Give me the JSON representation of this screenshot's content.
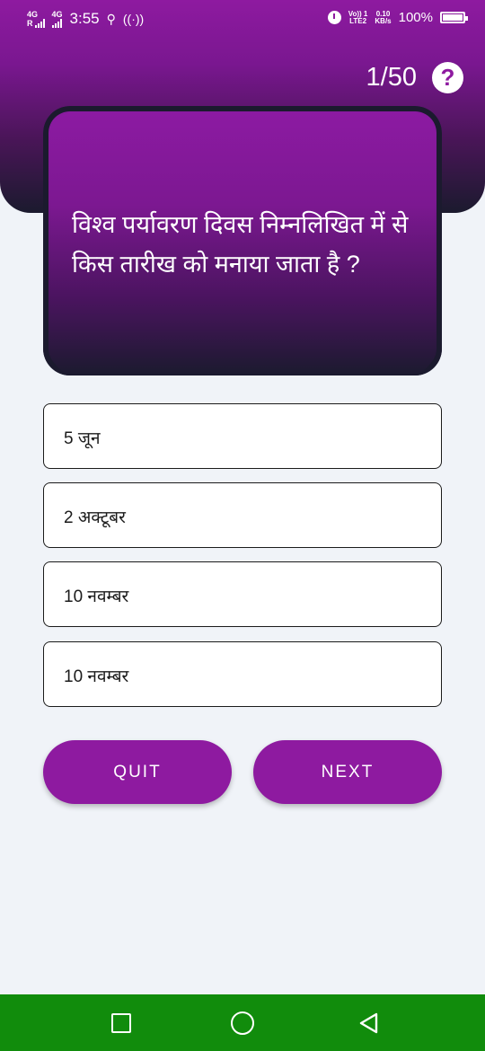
{
  "status_bar": {
    "network_1": "4G",
    "network_1_sub": "R",
    "network_2": "4G",
    "time": "3:55",
    "usb_icon": "usb-icon",
    "hotspot_icon": "hotspot-icon",
    "alarm_icon": "alarm-icon",
    "volte_top": "Vo)) 1",
    "volte_bottom": "LTE2",
    "speed_value": "0.10",
    "speed_unit": "KB/s",
    "battery_percent": "100%"
  },
  "header": {
    "counter": "1/50",
    "help_label": "?"
  },
  "question": {
    "text": "विश्व पर्यावरण दिवस निम्नलिखित में से किस तारीख को मनाया जाता है ?"
  },
  "options": [
    {
      "label": "5 जून"
    },
    {
      "label": "2 अक्टूबर"
    },
    {
      "label": "10 नवम्बर"
    },
    {
      "label": "10 नवम्बर"
    }
  ],
  "actions": {
    "quit_label": "QUIT",
    "next_label": "NEXT"
  },
  "colors": {
    "accent": "#8e1aa0",
    "dark": "#1b1a2e",
    "background": "#f0f3f8",
    "nav_bar": "#118c0c"
  },
  "nav_bar": {
    "recents_icon": "square-recents-icon",
    "home_icon": "circle-home-icon",
    "back_icon": "triangle-back-icon"
  }
}
